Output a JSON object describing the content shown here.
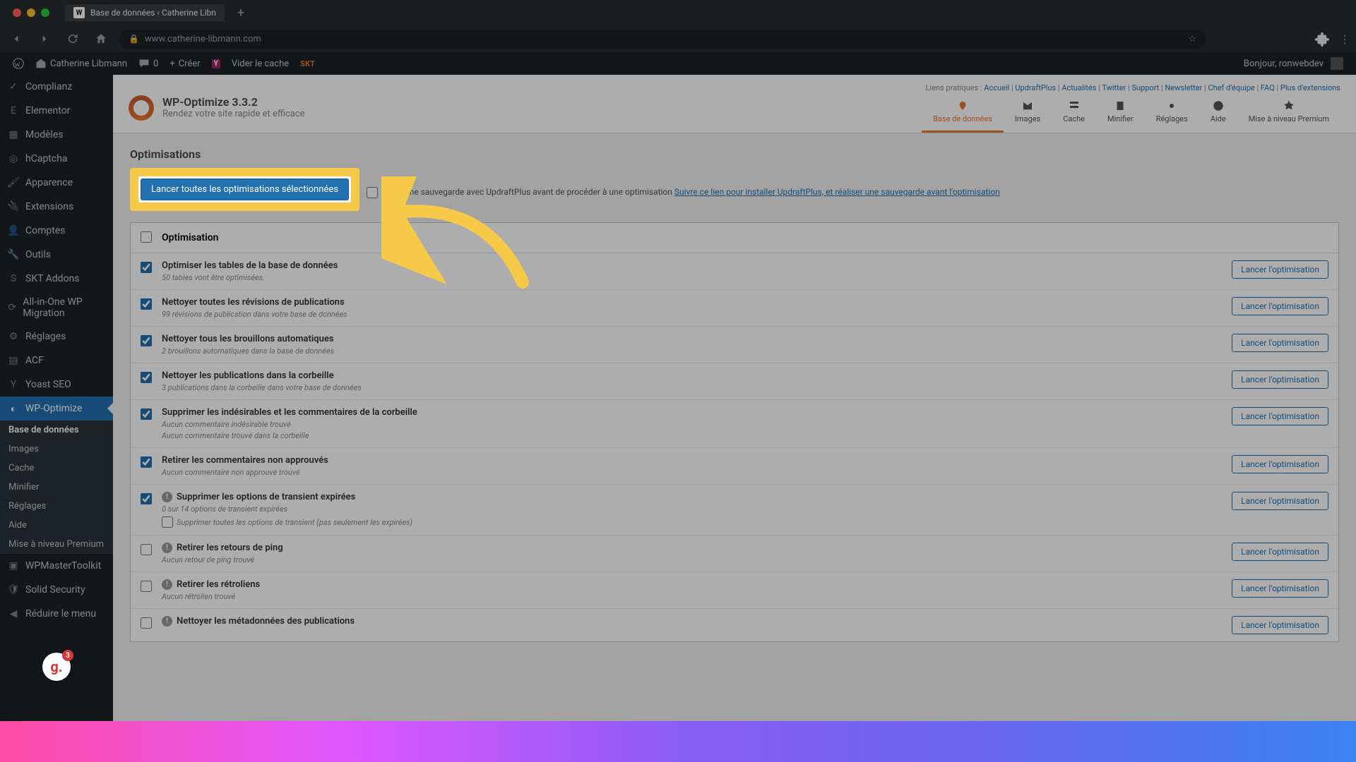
{
  "browser": {
    "tab_title": "Base de données ‹ Catherine Libn",
    "url": "www.catherine-libmann.com"
  },
  "adminbar": {
    "site_name": "Catherine Libmann",
    "comments": "0",
    "create": "Créer",
    "cache": "Vider le cache",
    "howdy": "Bonjour, ronwebdev"
  },
  "sidebar": {
    "items": [
      {
        "label": "Complianz",
        "icon": "✓"
      },
      {
        "label": "Elementor",
        "icon": "E"
      },
      {
        "label": "Modèles",
        "icon": "▦"
      },
      {
        "label": "hCaptcha",
        "icon": "◎"
      },
      {
        "label": "Apparence",
        "icon": "🖌"
      },
      {
        "label": "Extensions",
        "icon": "🔌"
      },
      {
        "label": "Comptes",
        "icon": "👤"
      },
      {
        "label": "Outils",
        "icon": "🔧"
      },
      {
        "label": "SKT Addons",
        "icon": "S"
      },
      {
        "label": "All-in-One WP Migration",
        "icon": "⟳"
      },
      {
        "label": "Réglages",
        "icon": "⚙"
      },
      {
        "label": "ACF",
        "icon": "▤"
      },
      {
        "label": "Yoast SEO",
        "icon": "Y"
      },
      {
        "label": "WP-Optimize",
        "icon": "◐",
        "current": true
      },
      {
        "label": "WPMasterToolkit",
        "icon": "▣"
      },
      {
        "label": "Solid Security",
        "icon": "🛡"
      },
      {
        "label": "Réduire le menu",
        "icon": "◀"
      }
    ],
    "submenu": [
      {
        "label": "Base de données",
        "current": true
      },
      {
        "label": "Images"
      },
      {
        "label": "Cache"
      },
      {
        "label": "Minifier"
      },
      {
        "label": "Réglages"
      },
      {
        "label": "Aide"
      },
      {
        "label": "Mise à niveau Premium"
      }
    ]
  },
  "wpo": {
    "title": "WP-Optimize 3.3.2",
    "subtitle": "Rendez votre site rapide et efficace",
    "quick_links_label": "Liens pratiques :",
    "quick_links": [
      "Accueil",
      "UpdraftPlus",
      "Actualités",
      "Twitter",
      "Support",
      "Newsletter",
      "Chef d'équipe",
      "FAQ",
      "Plus d'extensions"
    ],
    "tabs": [
      {
        "label": "Base de données"
      },
      {
        "label": "Images"
      },
      {
        "label": "Cache"
      },
      {
        "label": "Minifier"
      },
      {
        "label": "Réglages"
      },
      {
        "label": "Aide"
      },
      {
        "label": "Mise à niveau Premium"
      }
    ]
  },
  "panel": {
    "section": "Optimisations",
    "run_all": "Lancer toutes les optimisations sélectionnées",
    "backup_text": "Faire une sauvegarde avec UpdraftPlus avant de procéder à une optimisation ",
    "backup_link": "Suivre ce lien pour installer UpdraftPlus, et réaliser une sauvegarde avant l'optimisation",
    "col_header": "Optimisation",
    "run_btn": "Lancer l'optimisation",
    "rows": [
      {
        "checked": true,
        "name": "Optimiser les tables de la base de données",
        "desc": "50 tables vont être optimisées."
      },
      {
        "checked": true,
        "name": "Nettoyer toutes les révisions de publications",
        "desc": "99 révisions de publication dans votre base de données"
      },
      {
        "checked": true,
        "name": "Nettoyer tous les brouillons automatiques",
        "desc": "2 brouillons automatiques dans la base de données"
      },
      {
        "checked": true,
        "name": "Nettoyer les publications dans la corbeille",
        "desc": "3 publications dans la corbeille dans votre base de données"
      },
      {
        "checked": true,
        "name": "Supprimer les indésirables et les commentaires de la corbeille",
        "desc": "Aucun commentaire indésirable trouvé",
        "desc2": "Aucun commentaire trouvé dans la corbeille"
      },
      {
        "checked": true,
        "name": "Retirer les commentaires non approuvés",
        "desc": "Aucun commentaire non approuvé trouvé"
      },
      {
        "checked": true,
        "info": true,
        "name": "Supprimer les options de transient expirées",
        "desc": "0 sur 14 options de transient expirées",
        "subchk": "Supprimer toutes les options de transient (pas seulement les expirées)"
      },
      {
        "checked": false,
        "info": true,
        "name": "Retirer les retours de ping",
        "desc": "Aucun retour de ping trouvé"
      },
      {
        "checked": false,
        "info": true,
        "name": "Retirer les rétroliens",
        "desc": "Aucun rétrolien trouvé"
      },
      {
        "checked": false,
        "info": true,
        "name": "Nettoyer les métadonnées des publications",
        "desc": ""
      }
    ]
  }
}
